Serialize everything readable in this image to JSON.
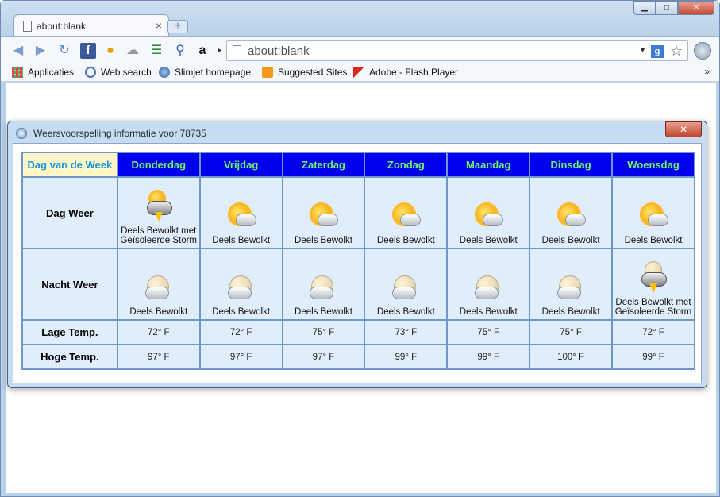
{
  "browser": {
    "tab_title": "about:blank",
    "tab_close": "×",
    "new_tab": "+",
    "window_buttons": {
      "minimize": "▁",
      "maximize": "□",
      "close": "✕"
    },
    "omnibox": {
      "url": "about:blank",
      "search_engine": "g"
    },
    "bookmarks": [
      {
        "label": "Applicaties",
        "icon": "apps-grid-icon"
      },
      {
        "label": "Web search",
        "icon": "search-icon"
      },
      {
        "label": "Slimjet homepage",
        "icon": "globe-icon"
      },
      {
        "label": "Suggested Sites",
        "icon": "suggested-sites-icon"
      },
      {
        "label": "Adobe - Flash Player",
        "icon": "adobe-icon"
      }
    ],
    "bookmarks_more": "»"
  },
  "dialog": {
    "title": "Weersvoorspelling informatie voor 78735",
    "close_label": "✕",
    "table": {
      "corner_label": "Dag van de Week",
      "days": [
        "Donderdag",
        "Vrijdag",
        "Zaterdag",
        "Zondag",
        "Maandag",
        "Dinsdag",
        "Woensdag"
      ],
      "row_labels": {
        "day_weather": "Dag Weer",
        "night_weather": "Nacht Weer",
        "low_temp": "Lage Temp.",
        "high_temp": "Hoge Temp."
      },
      "day_conditions": [
        {
          "text": "Deels Bewolkt met Geïsoleerde Storm",
          "icon": "storm-icon"
        },
        {
          "text": "Deels Bewolkt",
          "icon": "partly-cloudy-sun-icon"
        },
        {
          "text": "Deels Bewolkt",
          "icon": "partly-cloudy-sun-icon"
        },
        {
          "text": "Deels Bewolkt",
          "icon": "partly-cloudy-sun-icon"
        },
        {
          "text": "Deels Bewolkt",
          "icon": "partly-cloudy-sun-icon"
        },
        {
          "text": "Deels Bewolkt",
          "icon": "partly-cloudy-sun-icon"
        },
        {
          "text": "Deels Bewolkt",
          "icon": "partly-cloudy-sun-icon"
        }
      ],
      "night_conditions": [
        {
          "text": "Deels Bewolkt",
          "icon": "partly-cloudy-moon-icon"
        },
        {
          "text": "Deels Bewolkt",
          "icon": "partly-cloudy-moon-icon"
        },
        {
          "text": "Deels Bewolkt",
          "icon": "partly-cloudy-moon-icon"
        },
        {
          "text": "Deels Bewolkt",
          "icon": "partly-cloudy-moon-icon"
        },
        {
          "text": "Deels Bewolkt",
          "icon": "partly-cloudy-moon-icon"
        },
        {
          "text": "Deels Bewolkt",
          "icon": "partly-cloudy-moon-icon"
        },
        {
          "text": "Deels Bewolkt met Geïsoleerde Storm",
          "icon": "storm-icon"
        }
      ],
      "low_temps": [
        "72° F",
        "72° F",
        "75° F",
        "73° F",
        "75° F",
        "75° F",
        "72° F"
      ],
      "high_temps": [
        "97° F",
        "97° F",
        "97° F",
        "99° F",
        "99° F",
        "100° F",
        "99° F"
      ]
    }
  },
  "colors": {
    "header_bg": "#0000ee",
    "header_text": "#6cf36c",
    "corner_bg": "#fff6c8",
    "corner_text": "#1596e0",
    "cell_bg": "#e0edfa",
    "grid_border": "#6f97c9"
  }
}
